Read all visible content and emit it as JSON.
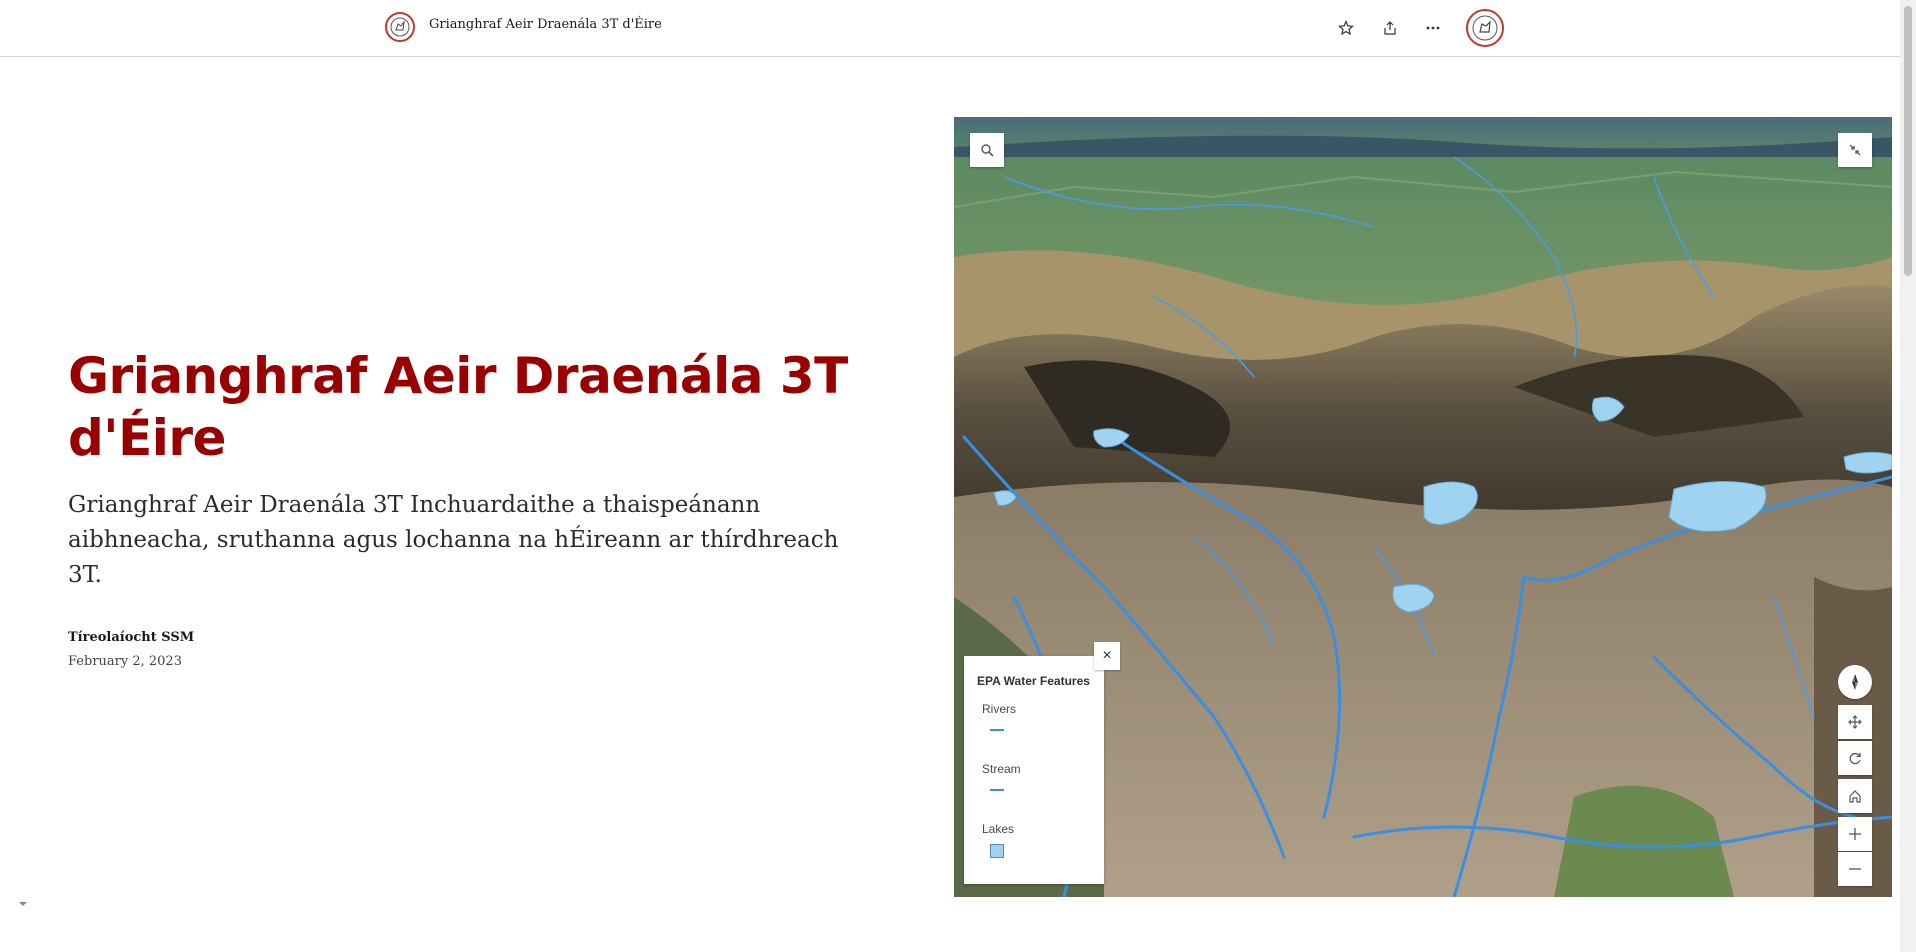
{
  "header": {
    "title": "Grianghraf Aeir Draenála 3T d'Éire",
    "icons": [
      "logo-icon",
      "star-icon",
      "share-icon",
      "more-icon",
      "avatar-icon"
    ]
  },
  "hero": {
    "title": "Grianghraf Aeir Draenála 3T d'Éire",
    "subtitle": "Grianghraf Aeir Draenála 3T Inchuardaithe a thaispeánann aibhneacha, sruthanna agus lochanna na hÉireann ar thírdhreach 3T.",
    "author": "Tíreolaíocht SSM",
    "date": "February 2, 2023"
  },
  "map": {
    "legend": {
      "title": "EPA Water Features",
      "close_label": "×",
      "items": [
        {
          "label": "Rivers",
          "symbol": "line",
          "color": "#3a8fe0"
        },
        {
          "label": "Stream",
          "symbol": "line",
          "color": "#3a8fe0"
        },
        {
          "label": "Lakes",
          "symbol": "fill",
          "color": "#9fd3f0"
        }
      ]
    },
    "controls": [
      "search-icon",
      "collapse-icon",
      "compass-icon",
      "pan-icon",
      "rotate-icon",
      "home-icon",
      "zoom-in-icon",
      "zoom-out-icon"
    ]
  },
  "colors": {
    "accent": "#990000",
    "water": "#3a8fe0",
    "lake_fill": "#9fd3f0"
  }
}
